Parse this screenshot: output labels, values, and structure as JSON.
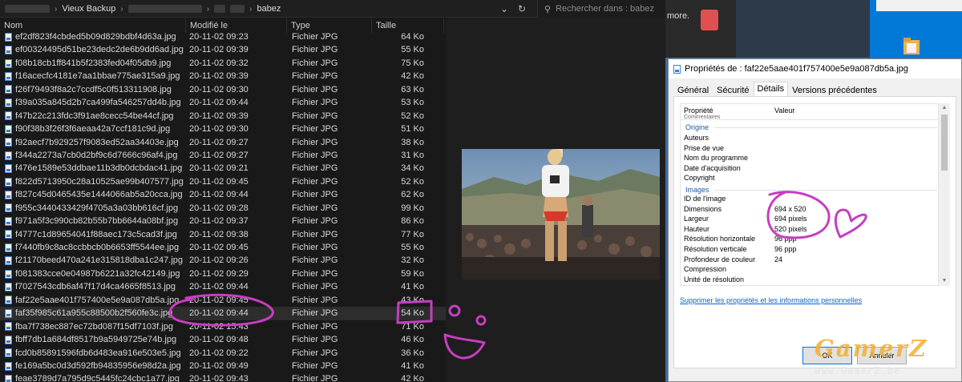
{
  "explorer": {
    "breadcrumb": [
      "Vieux Backup",
      "babez"
    ],
    "search_placeholder": "Rechercher dans : babez",
    "columns": {
      "name": "Nom",
      "date": "Modifié le",
      "type": "Type",
      "size": "Taille"
    },
    "files": [
      {
        "name": "ef2df823f4cbded5b09d829bdbf4d63a.jpg",
        "date": "20-11-02 09:23",
        "type": "Fichier JPG",
        "size": "64 Ko"
      },
      {
        "name": "ef00324495d51be23dedc2de6b9dd6ad.jpg",
        "date": "20-11-02 09:39",
        "type": "Fichier JPG",
        "size": "55 Ko"
      },
      {
        "name": "f08b18cb1ff841b5f2383fed04f05db9.jpg",
        "date": "20-11-02 09:32",
        "type": "Fichier JPG",
        "size": "75 Ko"
      },
      {
        "name": "f16acecfc4181e7aa1bbae775ae315a9.jpg",
        "date": "20-11-02 09:39",
        "type": "Fichier JPG",
        "size": "42 Ko"
      },
      {
        "name": "f26f79493f8a2c7ccdf5c0f513311908.jpg",
        "date": "20-11-02 09:30",
        "type": "Fichier JPG",
        "size": "63 Ko"
      },
      {
        "name": "f39a035a845d2b7ca499fa546257dd4b.jpg",
        "date": "20-11-02 09:44",
        "type": "Fichier JPG",
        "size": "53 Ko"
      },
      {
        "name": "f47b22c213fdc3f91ae8cecc54be44cf.jpg",
        "date": "20-11-02 09:39",
        "type": "Fichier JPG",
        "size": "52 Ko"
      },
      {
        "name": "f90f38b3f26f3f6aeaa42a7ccf181c9d.jpg",
        "date": "20-11-02 09:30",
        "type": "Fichier JPG",
        "size": "51 Ko"
      },
      {
        "name": "f92aecf7b929257f9083ed52aa34403e.jpg",
        "date": "20-11-02 09:27",
        "type": "Fichier JPG",
        "size": "38 Ko"
      },
      {
        "name": "f344a2273a7cb0d2bf9c6d7666c96af4.jpg",
        "date": "20-11-02 09:27",
        "type": "Fichier JPG",
        "size": "31 Ko"
      },
      {
        "name": "f476e1589e53ddbae11b3db0dcbdac41.jpg",
        "date": "20-11-02 09:21",
        "type": "Fichier JPG",
        "size": "34 Ko"
      },
      {
        "name": "f822d5713950c28a10525ae99b407577.jpg",
        "date": "20-11-02 09:45",
        "type": "Fichier JPG",
        "size": "52 Ko"
      },
      {
        "name": "f827c45d0465435e1444066ab5a20cca.jpg",
        "date": "20-11-02 09:44",
        "type": "Fichier JPG",
        "size": "62 Ko"
      },
      {
        "name": "f955c3440433429f4705a3a03bb616cf.jpg",
        "date": "20-11-02 09:28",
        "type": "Fichier JPG",
        "size": "99 Ko"
      },
      {
        "name": "f971a5f3c990cb82b55b7bb6644a08bf.jpg",
        "date": "20-11-02 09:37",
        "type": "Fichier JPG",
        "size": "86 Ko"
      },
      {
        "name": "f4777c1d89654041f88aec173c5cad3f.jpg",
        "date": "20-11-02 09:38",
        "type": "Fichier JPG",
        "size": "77 Ko"
      },
      {
        "name": "f7440fb9c8ac8ccbbcb0b6653ff5544ee.jpg",
        "date": "20-11-02 09:45",
        "type": "Fichier JPG",
        "size": "55 Ko"
      },
      {
        "name": "f21170beed470a241e315818dba1c247.jpg",
        "date": "20-11-02 09:26",
        "type": "Fichier JPG",
        "size": "32 Ko"
      },
      {
        "name": "f081383cce0e04987b6221a32fc42149.jpg",
        "date": "20-11-02 09:29",
        "type": "Fichier JPG",
        "size": "59 Ko"
      },
      {
        "name": "f7027543cdb6af47f17d4ca4665f8513.jpg",
        "date": "20-11-02 09:44",
        "type": "Fichier JPG",
        "size": "41 Ko"
      },
      {
        "name": "faf22e5aae401f757400e5e9a087db5a.jpg",
        "date": "20-11-02 09:45",
        "type": "Fichier JPG",
        "size": "43 Ko"
      },
      {
        "name": "faf35f985c61a955c88500b2f560fe3c.jpg",
        "date": "20-11-02 09:44",
        "type": "Fichier JPG",
        "size": "54 Ko"
      },
      {
        "name": "fba7f738ec887ec72bd087f15df7103f.jpg",
        "date": "20-11-02 15:43",
        "type": "Fichier JPG",
        "size": "71 Ko"
      },
      {
        "name": "fbff7db1a684df8517b9a5949725e74b.jpg",
        "date": "20-11-02 09:48",
        "type": "Fichier JPG",
        "size": "46 Ko"
      },
      {
        "name": "fcd0b85891596fdb6d483ea916e503e5.jpg",
        "date": "20-11-02 09:22",
        "type": "Fichier JPG",
        "size": "36 Ko"
      },
      {
        "name": "fe169a5bc0d3d592fb94835956e98d2a.jpg",
        "date": "20-11-02 09:49",
        "type": "Fichier JPG",
        "size": "41 Ko"
      },
      {
        "name": "feae3789d7a795d9c5445fc24cbc1a77.jpg",
        "date": "20-11-02 09:43",
        "type": "Fichier JPG",
        "size": "42 Ko"
      }
    ],
    "selected_index": 21
  },
  "background": {
    "partial_text": "more."
  },
  "dialog": {
    "title": "Propriétés de : faf22e5aae401f757400e5e9a087db5a.jpg",
    "tabs": [
      "Général",
      "Sécurité",
      "Détails",
      "Versions précédentes"
    ],
    "active_tab": 2,
    "columns": {
      "prop": "Propriété",
      "value": "Valeur"
    },
    "header_fragment": "Commentaires",
    "groups": {
      "origine": "Origine",
      "images": "Images"
    },
    "origine_rows": [
      "Auteurs",
      "Prise de vue",
      "Nom du programme",
      "Date d'acquisition",
      "Copyright"
    ],
    "image_rows": [
      {
        "label": "ID de l'image",
        "value": ""
      },
      {
        "label": "Dimensions",
        "value": "694 x 520"
      },
      {
        "label": "Largeur",
        "value": "694 pixels"
      },
      {
        "label": "Hauteur",
        "value": "520 pixels"
      },
      {
        "label": "Résolution horizontale",
        "value": "96 ppp"
      },
      {
        "label": "Résolution verticale",
        "value": "96 ppp"
      },
      {
        "label": "Profondeur de couleur",
        "value": "24"
      },
      {
        "label": "Compression",
        "value": ""
      },
      {
        "label": "Unité de résolution",
        "value": ""
      }
    ],
    "link": "Supprimer les propriétés et les informations personnelles",
    "ok_label": "OK",
    "cancel_label": "Annuler"
  },
  "watermark": {
    "logo": "GamerZ",
    "url": "www.GamerZ.be"
  },
  "colors": {
    "explorer_bg": "#191919",
    "annotation": "#c63ec0",
    "link": "#0a63c9",
    "group_header": "#1c5aa6",
    "desktop_blue": "#3a6ea5"
  }
}
